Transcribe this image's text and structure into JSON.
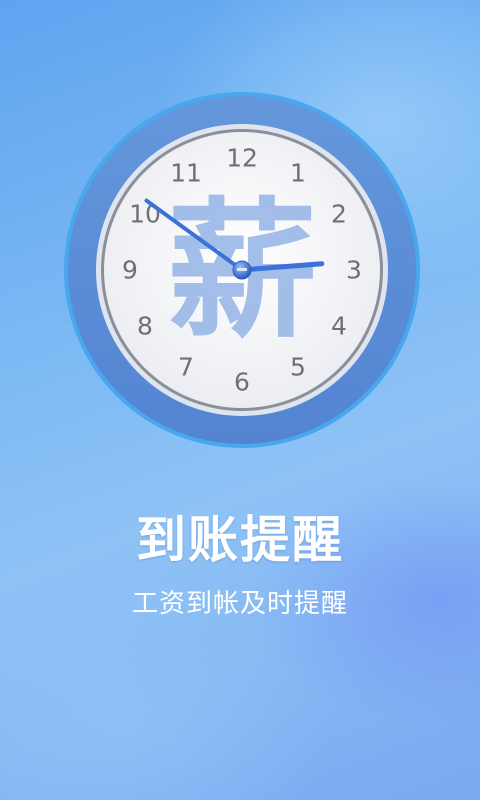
{
  "clock": {
    "numbers": [
      "12",
      "1",
      "2",
      "3",
      "4",
      "5",
      "6",
      "7",
      "8",
      "9",
      "10",
      "11"
    ],
    "center_character": "薪",
    "time": {
      "hour": 2,
      "minute": 51
    },
    "colors": {
      "outer_ring": "#5b8fd9",
      "outer_ring_edge": "#4aa8ec",
      "face": "#f4f4f7",
      "hands": "#3a72d8",
      "watermark": "#8fb0e3"
    }
  },
  "splash": {
    "title": "到账提醒",
    "subtitle": "工资到帐及时提醒"
  }
}
